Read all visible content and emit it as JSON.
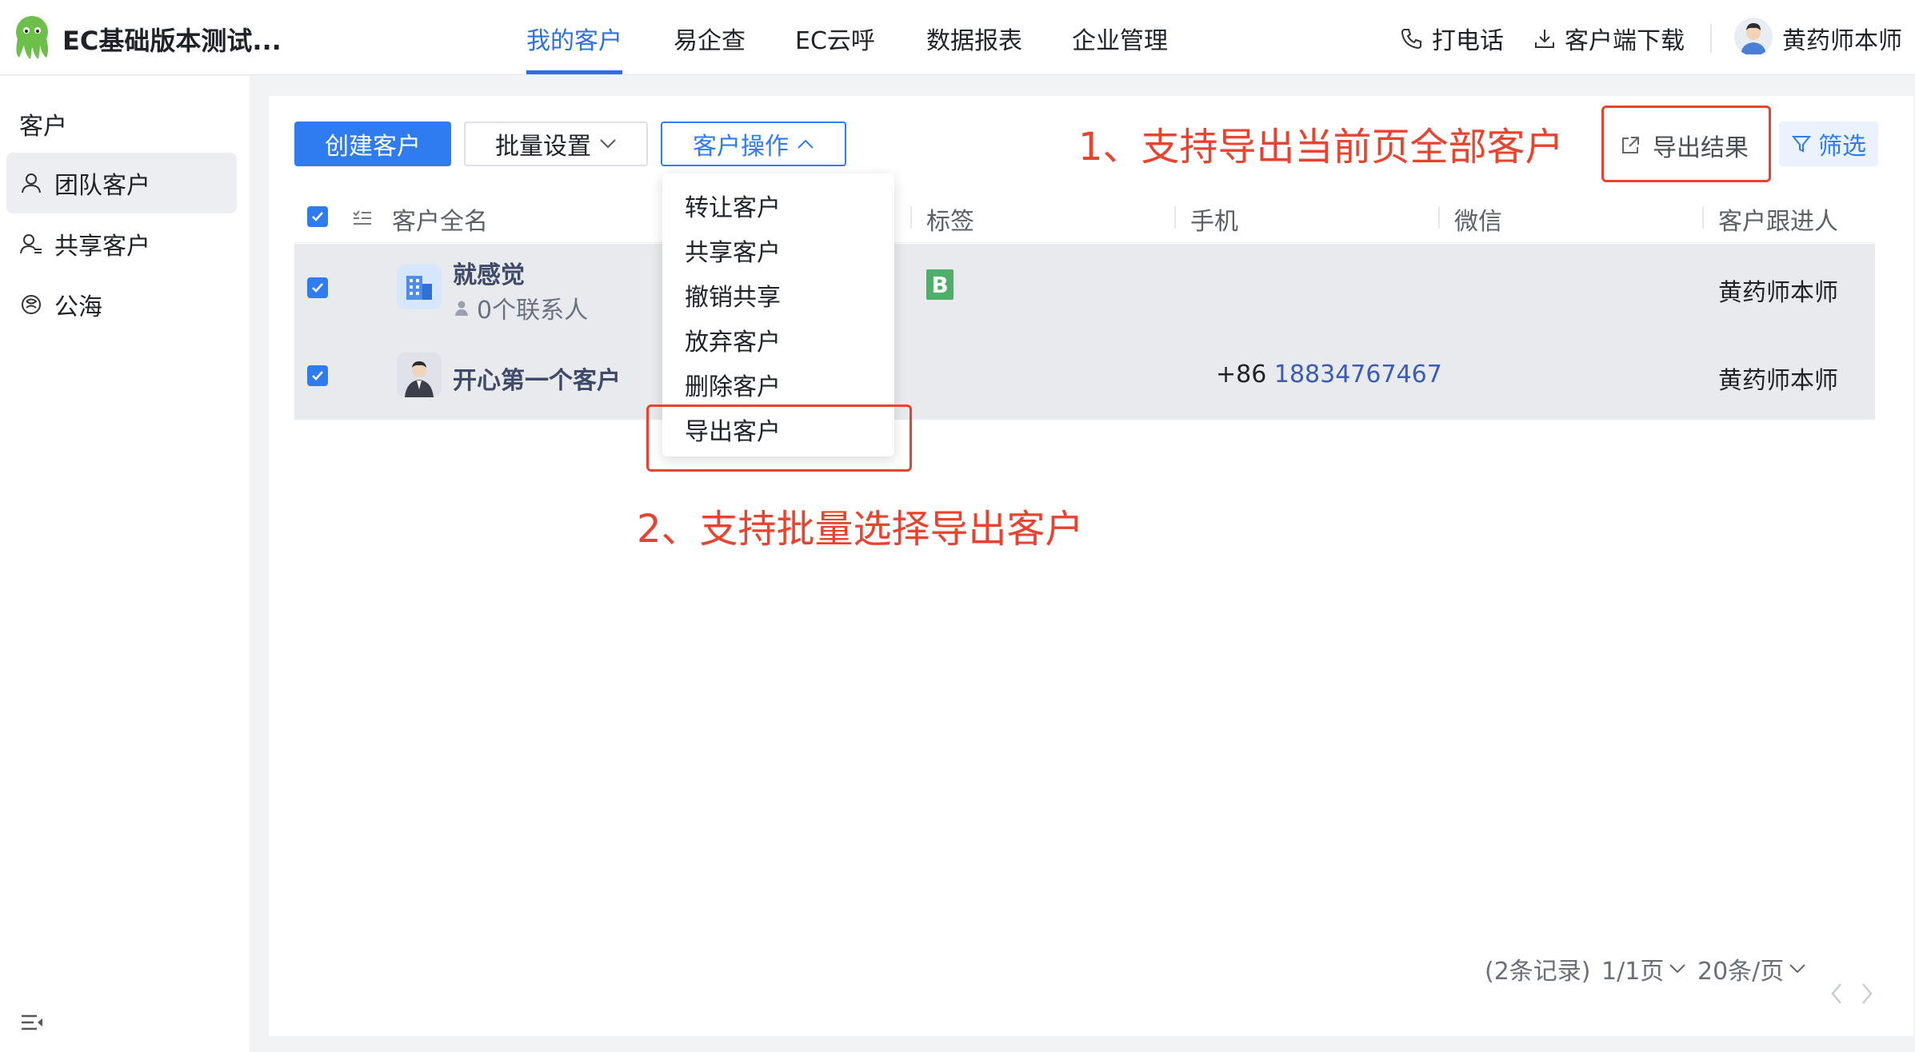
{
  "header": {
    "app_title": "EC基础版本测试...",
    "nav": [
      "我的客户",
      "易企查",
      "EC云呼",
      "数据报表",
      "企业管理"
    ],
    "call_label": "打电话",
    "download_label": "客户端下载",
    "user_name": "黄药师本师"
  },
  "sidebar": {
    "heading": "客户",
    "items": [
      {
        "label": "团队客户",
        "icon": "user-icon"
      },
      {
        "label": "共享客户",
        "icon": "shared-user-icon"
      },
      {
        "label": "公海",
        "icon": "sea-icon"
      }
    ]
  },
  "toolbar": {
    "create_label": "创建客户",
    "batch_label": "批量设置",
    "ops_label": "客户操作",
    "export_label": "导出结果",
    "filter_label": "筛选"
  },
  "annotations": {
    "note1": "1、支持导出当前页全部客户",
    "note2": "2、支持批量选择导出客户"
  },
  "table": {
    "columns": [
      "客户全名",
      "标签",
      "手机",
      "微信",
      "客户跟进人"
    ],
    "rows": [
      {
        "name": "就感觉",
        "contacts": "0个联系人",
        "tag": "B",
        "phone_prefix": "",
        "phone": "",
        "owner": "黄药师本师"
      },
      {
        "name": "开心第一个客户",
        "contacts": "",
        "tag": "",
        "phone_prefix": "+86",
        "phone": "18834767467",
        "owner": "黄药师本师"
      }
    ]
  },
  "dropdown": {
    "items": [
      "转让客户",
      "共享客户",
      "撤销共享",
      "放弃客户",
      "删除客户",
      "导出客户"
    ]
  },
  "pagination": {
    "records": "(2条记录)",
    "page": "1/1页",
    "per_page": "20条/页"
  },
  "colors": {
    "accent": "#2f7cf0",
    "annotation": "#e8432f",
    "tag_green": "#4fae6a"
  }
}
